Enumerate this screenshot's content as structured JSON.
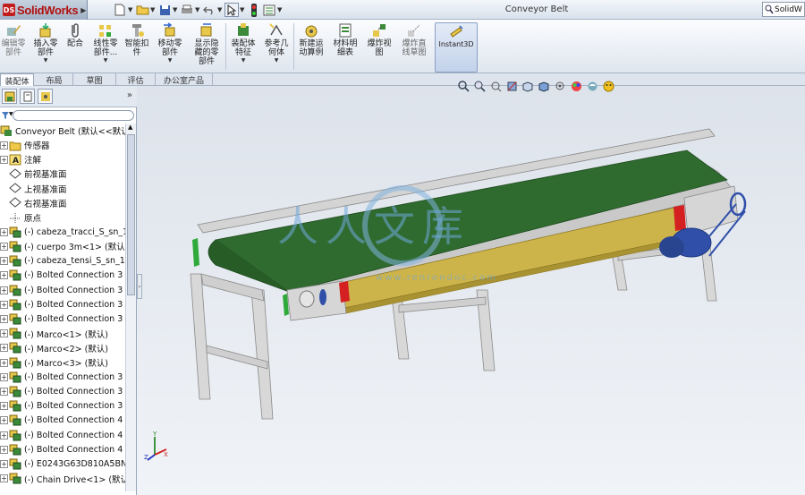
{
  "app": {
    "name": "SolidWorks",
    "badge": "DS"
  },
  "document": {
    "title": "Conveyor Belt"
  },
  "search": {
    "value": "SolidW"
  },
  "quick_access": [
    {
      "icon": "new-document-icon"
    },
    {
      "icon": "open-folder-icon"
    },
    {
      "icon": "save-icon"
    },
    {
      "icon": "print-icon"
    },
    {
      "icon": "undo-icon"
    },
    {
      "icon": "select-arrow-icon"
    },
    {
      "icon": "rebuild-traffic-light-icon"
    },
    {
      "icon": "options-icon"
    }
  ],
  "ribbon": {
    "edit_component": "编辑零\n部件",
    "insert_component": "插入零\n部件",
    "mate": "配合",
    "linear_pattern": "线性零\n部件...",
    "smart_fasteners": "智能扣\n件",
    "move_component": "移动零\n部件",
    "show_hidden": "显示隐\n藏的零\n部件",
    "assembly_features": "装配体\n特征",
    "reference_geometry": "参考几\n何体",
    "new_motion_study": "新建运\n动算例",
    "bill_of_materials": "材料明\n细表",
    "exploded_view": "爆炸视\n图",
    "explode_line_sketch": "爆炸直\n线草图",
    "instant3d": "Instant3D"
  },
  "tabs": [
    "装配体",
    "布局",
    "草图",
    "评估",
    "办公室产品"
  ],
  "filter": {
    "value": ""
  },
  "tree": {
    "root": "Conveyor Belt  (默认<<默认",
    "items": [
      {
        "label": "传感器",
        "icon": "sensor-folder-icon",
        "exp": "+",
        "kind": "folder"
      },
      {
        "label": "注解",
        "icon": "annotation-icon",
        "exp": "+",
        "kind": "annot"
      },
      {
        "label": "前视基准面",
        "icon": "plane-icon",
        "exp": "",
        "kind": "plane"
      },
      {
        "label": "上视基准面",
        "icon": "plane-icon",
        "exp": "",
        "kind": "plane"
      },
      {
        "label": "右视基准面",
        "icon": "plane-icon",
        "exp": "",
        "kind": "plane"
      },
      {
        "label": "原点",
        "icon": "origin-icon",
        "exp": "",
        "kind": "origin"
      },
      {
        "label": "(-) cabeza_tracci_S_sn_1",
        "icon": "subassembly-icon",
        "exp": "+",
        "kind": "asm"
      },
      {
        "label": "(-) cuerpo 3m<1> (默认",
        "icon": "subassembly-icon",
        "exp": "+",
        "kind": "asm"
      },
      {
        "label": "(-) cabeza_tensi_S_sn_1-",
        "icon": "subassembly-icon",
        "exp": "+",
        "kind": "asm"
      },
      {
        "label": "(-) Bolted Connection 3",
        "icon": "subassembly-icon",
        "exp": "+",
        "kind": "asm"
      },
      {
        "label": "(-) Bolted Connection 3",
        "icon": "subassembly-icon",
        "exp": "+",
        "kind": "asm"
      },
      {
        "label": "(-) Bolted Connection 3",
        "icon": "subassembly-icon",
        "exp": "+",
        "kind": "asm"
      },
      {
        "label": "(-) Bolted Connection 3",
        "icon": "subassembly-icon",
        "exp": "+",
        "kind": "asm"
      },
      {
        "label": "(-) Marco<1> (默认)",
        "icon": "subassembly-icon",
        "exp": "+",
        "kind": "asm"
      },
      {
        "label": "(-) Marco<2> (默认)",
        "icon": "subassembly-icon",
        "exp": "+",
        "kind": "asm"
      },
      {
        "label": "(-) Marco<3> (默认)",
        "icon": "subassembly-icon",
        "exp": "+",
        "kind": "asm"
      },
      {
        "label": "(-) Bolted Connection 3",
        "icon": "subassembly-icon",
        "exp": "+",
        "kind": "asm"
      },
      {
        "label": "(-) Bolted Connection 3",
        "icon": "subassembly-icon",
        "exp": "+",
        "kind": "asm"
      },
      {
        "label": "(-) Bolted Connection 3",
        "icon": "subassembly-icon",
        "exp": "+",
        "kind": "asm"
      },
      {
        "label": "(-) Bolted Connection 4",
        "icon": "subassembly-icon",
        "exp": "+",
        "kind": "asm"
      },
      {
        "label": "(-) Bolted Connection 4",
        "icon": "subassembly-icon",
        "exp": "+",
        "kind": "asm"
      },
      {
        "label": "(-) Bolted Connection 4",
        "icon": "subassembly-icon",
        "exp": "+",
        "kind": "asm"
      },
      {
        "label": "(-) E0243G63D810A5BN",
        "icon": "subassembly-icon",
        "exp": "+",
        "kind": "asm"
      },
      {
        "label": "(-) Chain Drive<1> (默认",
        "icon": "subassembly-icon",
        "exp": "+",
        "kind": "asm"
      }
    ]
  },
  "triad": {
    "x": "X",
    "y": "Y",
    "z": "Z"
  },
  "watermark": {
    "line1": "人人文库",
    "line2": "www.renrendoc.com"
  },
  "colors": {
    "belt": "#2f6b2f",
    "frame": "#c8c8c8",
    "side_panel": "#c9b24a",
    "motor": "#2f4fa8",
    "accent_red": "#d42020"
  }
}
